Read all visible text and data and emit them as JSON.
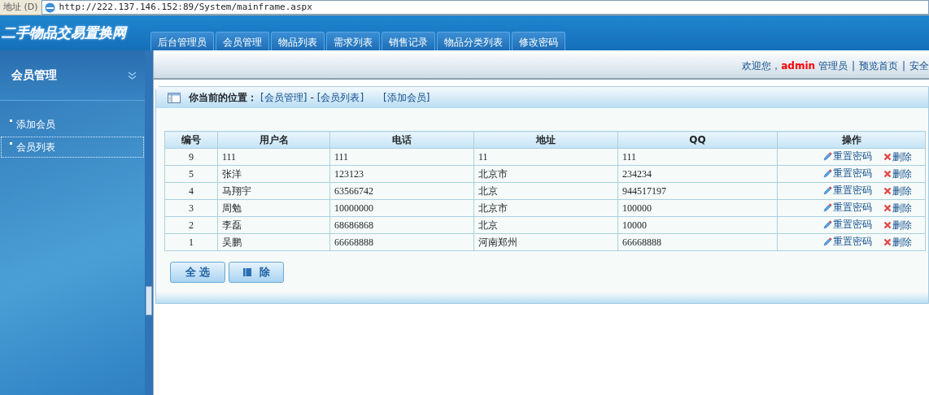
{
  "address_bar": {
    "label": "地址 (D)",
    "url": "http://222.137.146.152:89/System/mainframe.aspx"
  },
  "header": {
    "logo": "二手物品交易置换网",
    "tabs": [
      {
        "label": "后台管理员",
        "selected": false
      },
      {
        "label": "会员管理",
        "selected": false
      },
      {
        "label": "物品列表",
        "selected": false
      },
      {
        "label": "需求列表",
        "selected": false
      },
      {
        "label": "销售记录",
        "selected": false
      },
      {
        "label": "物品分类列表",
        "selected": false
      },
      {
        "label": "修改密码",
        "selected": false
      }
    ]
  },
  "sidebar": {
    "title": "会员管理",
    "items": [
      {
        "label": "添加会员",
        "selected": false
      },
      {
        "label": "会员列表",
        "selected": true
      }
    ]
  },
  "top_bar": {
    "greeting": "欢迎您，",
    "user": "admin",
    "role": "管理员",
    "separator": "|",
    "links": [
      "预览首页",
      "安全"
    ]
  },
  "panel": {
    "location_label": "你当前的位置：",
    "breadcrumb": [
      "[会员管理]",
      "-",
      "[会员列表]"
    ],
    "action_link": "[添加会员]"
  },
  "table": {
    "columns": [
      "编号",
      "用户名",
      "电话",
      "地址",
      "QQ",
      "操作"
    ],
    "rows": [
      {
        "cells": [
          "9",
          "111",
          "111",
          "11",
          "111"
        ],
        "actions": [
          "重置密码",
          "删除"
        ]
      },
      {
        "cells": [
          "5",
          "张洋",
          "123123",
          "北京市",
          "234234"
        ],
        "actions": [
          "重置密码",
          "删除"
        ]
      },
      {
        "cells": [
          "4",
          "马翔宇",
          "63566742",
          "北京",
          "944517197"
        ],
        "actions": [
          "重置密码",
          "删除"
        ]
      },
      {
        "cells": [
          "3",
          "周勉",
          "10000000",
          "北京市",
          "100000"
        ],
        "actions": [
          "重置密码",
          "删除"
        ]
      },
      {
        "cells": [
          "2",
          "李磊",
          "68686868",
          "北京",
          "10000"
        ],
        "actions": [
          "重置密码",
          "删除"
        ]
      },
      {
        "cells": [
          "1",
          "吴鹏",
          "66668888",
          "河南郑州",
          "66668888"
        ],
        "actions": [
          "重置密码",
          "删除"
        ]
      }
    ]
  },
  "buttons": [
    {
      "label": "全 选",
      "kind": "plain"
    },
    {
      "label": "除",
      "kind": "delete"
    }
  ]
}
